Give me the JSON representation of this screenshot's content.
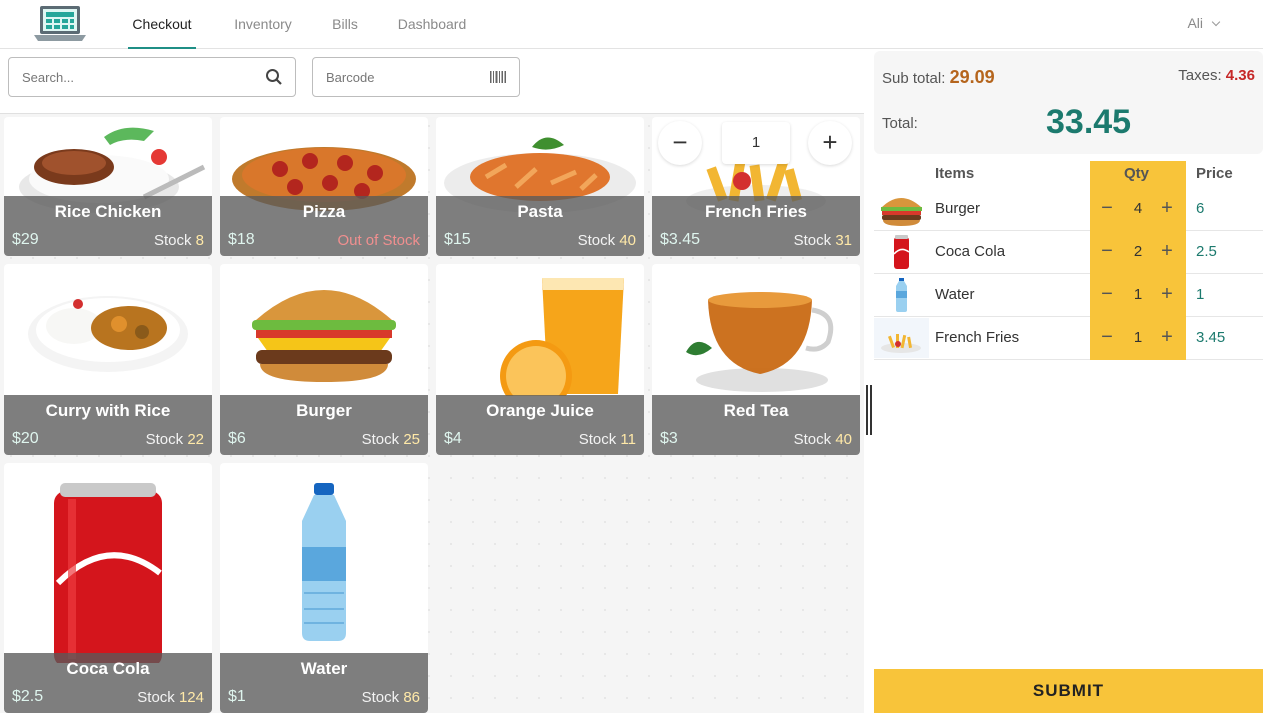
{
  "nav": {
    "tabs": [
      {
        "label": "Checkout"
      },
      {
        "label": "Inventory"
      },
      {
        "label": "Bills"
      },
      {
        "label": "Dashboard"
      }
    ],
    "user": "Ali"
  },
  "search": {
    "placeholder": "Search..."
  },
  "barcode": {
    "placeholder": "Barcode"
  },
  "products": [
    {
      "name": "Rice Chicken",
      "price": "$29",
      "stock_label": "Stock",
      "stock": "8"
    },
    {
      "name": "Pizza",
      "price": "$18",
      "stock_label": "Out of Stock",
      "stock": ""
    },
    {
      "name": "Pasta",
      "price": "$15",
      "stock_label": "Stock",
      "stock": "40"
    },
    {
      "name": "French Fries",
      "price": "$3.45",
      "stock_label": "Stock",
      "stock": "31"
    },
    {
      "name": "Curry with Rice",
      "price": "$20",
      "stock_label": "Stock",
      "stock": "22"
    },
    {
      "name": "Burger",
      "price": "$6",
      "stock_label": "Stock",
      "stock": "25"
    },
    {
      "name": "Orange Juice",
      "price": "$4",
      "stock_label": "Stock",
      "stock": "11"
    },
    {
      "name": "Red Tea",
      "price": "$3",
      "stock_label": "Stock",
      "stock": "40"
    },
    {
      "name": "Coca Cola",
      "price": "$2.5",
      "stock_label": "Stock",
      "stock": "124"
    },
    {
      "name": "Water",
      "price": "$1",
      "stock_label": "Stock",
      "stock": "86"
    }
  ],
  "hover_control": {
    "minus": "−",
    "qty": "1",
    "plus": "+"
  },
  "summary": {
    "subtotal_label": "Sub total:",
    "subtotal": "29.09",
    "taxes_label": "Taxes:",
    "taxes": "4.36",
    "total_label": "Total:",
    "total": "33.45"
  },
  "cart": {
    "headers": {
      "items": "Items",
      "qty": "Qty",
      "price": "Price"
    },
    "rows": [
      {
        "name": "Burger",
        "qty": "4",
        "price": "6"
      },
      {
        "name": "Coca Cola",
        "qty": "2",
        "price": "2.5"
      },
      {
        "name": "Water",
        "qty": "1",
        "price": "1"
      },
      {
        "name": "French Fries",
        "qty": "1",
        "price": "3.45"
      }
    ],
    "minus": "−",
    "plus": "+"
  },
  "submit_label": "SUBMIT",
  "colors": {
    "accent": "#1f8f86",
    "qty_bg": "#f8c43a",
    "total": "#1c7a6e",
    "subtotal": "#b5651d",
    "taxes": "#c62828"
  }
}
